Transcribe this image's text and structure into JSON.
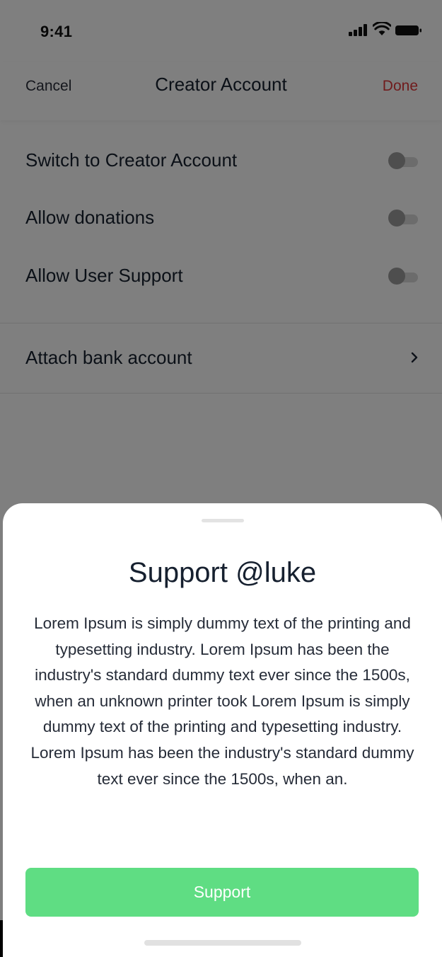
{
  "status_bar": {
    "time": "9:41",
    "icons": [
      "signal-icon",
      "wifi-icon",
      "battery-icon"
    ]
  },
  "nav": {
    "cancel_label": "Cancel",
    "title": "Creator Account",
    "done_label": "Done"
  },
  "settings": {
    "items": [
      {
        "label": "Switch to Creator Account",
        "enabled": false
      },
      {
        "label": "Allow donations",
        "enabled": false
      },
      {
        "label": "Allow User Support",
        "enabled": false
      }
    ],
    "bank": {
      "label": "Attach bank account",
      "icon": "chevron-right-icon"
    }
  },
  "sheet": {
    "title": "Support @luke",
    "body": "Lorem Ipsum is simply dummy text of the printing and typesetting industry. Lorem Ipsum has been the industry's standard dummy text ever since the 1500s, when an unknown printer took Lorem Ipsum is simply dummy text of the printing and typesetting industry. Lorem Ipsum has been the industry's standard dummy text ever since the 1500s, when an.",
    "button_label": "Support"
  },
  "colors": {
    "accent_done": "#e0383a",
    "support_button": "#5fdd83",
    "overlay": "rgba(0,0,0,0.5)"
  }
}
